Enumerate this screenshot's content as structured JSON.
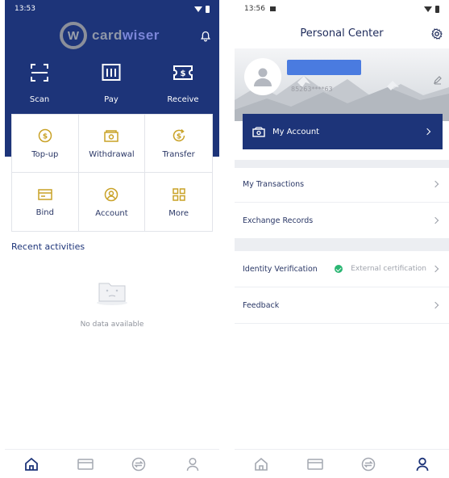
{
  "home": {
    "status_time": "13:53",
    "brand": {
      "prefix": "card",
      "suffix": "wiser",
      "mark_letter": "W"
    },
    "quick_actions": [
      {
        "label": "Scan",
        "icon": "scan-icon"
      },
      {
        "label": "Pay",
        "icon": "pay-icon"
      },
      {
        "label": "Receive",
        "icon": "receive-icon"
      }
    ],
    "services": [
      {
        "label": "Top-up",
        "icon": "top-up-icon"
      },
      {
        "label": "Withdrawal",
        "icon": "withdrawal-icon"
      },
      {
        "label": "Transfer",
        "icon": "transfer-icon"
      },
      {
        "label": "Bind",
        "icon": "card-icon"
      },
      {
        "label": "Account",
        "icon": "user-circle-icon"
      },
      {
        "label": "More",
        "icon": "grid-icon"
      }
    ],
    "recent_title": "Recent activities",
    "empty_text": "No data available",
    "active_tab": "home"
  },
  "personal": {
    "status_time": "13:56",
    "title": "Personal Center",
    "phone": "85263****63",
    "account_label": "My Account",
    "rows": [
      {
        "label": "My Transactions"
      },
      {
        "label": "Exchange Records"
      },
      {
        "label": "Identity Verification",
        "extra": "External certification",
        "verified": true
      },
      {
        "label": "Feedback"
      }
    ],
    "active_tab": "profile"
  },
  "colors": {
    "primary": "#1d3479",
    "gold": "#c9a227",
    "verified": "#2bb673",
    "name_placeholder": "#4a7be0"
  },
  "tabs": [
    "home-icon",
    "card-icon",
    "exchange-icon",
    "user-icon"
  ]
}
